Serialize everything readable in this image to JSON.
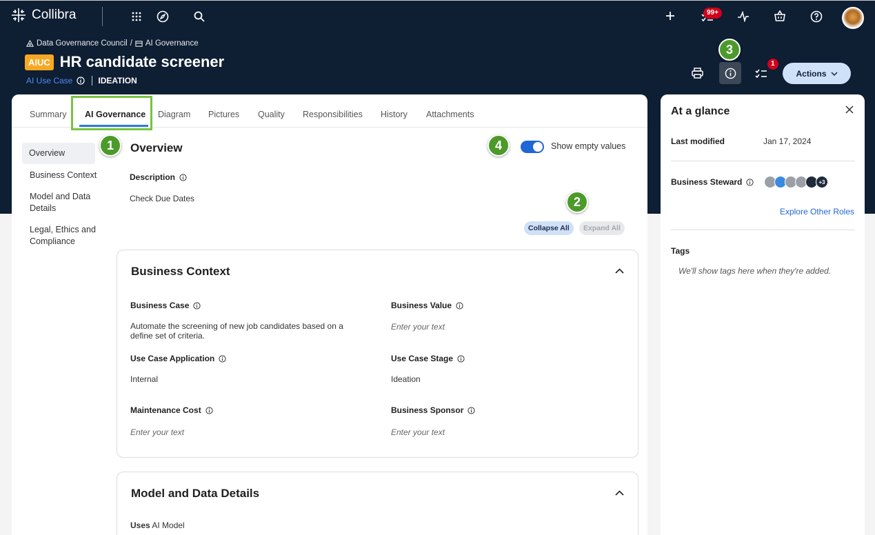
{
  "app": {
    "name": "Collibra"
  },
  "topnav": {
    "tasks_badge": "99+",
    "notifications_badge": "1"
  },
  "breadcrumb": {
    "community": "Data Governance Council",
    "separator": "/",
    "domain": "AI Governance"
  },
  "asset": {
    "type_badge": "AIUC",
    "title": "HR candidate screener",
    "type": "AI Use Case",
    "status": "IDEATION"
  },
  "header": {
    "actions_label": "Actions"
  },
  "callouts": {
    "c1": "1",
    "c2": "2",
    "c3": "3",
    "c4": "4"
  },
  "tabs": [
    {
      "label": "Summary"
    },
    {
      "label": "AI Governance"
    },
    {
      "label": "Diagram"
    },
    {
      "label": "Pictures"
    },
    {
      "label": "Quality"
    },
    {
      "label": "Responsibilities"
    },
    {
      "label": "History"
    },
    {
      "label": "Attachments"
    }
  ],
  "sidenav": [
    {
      "label": "Overview"
    },
    {
      "label": "Business Context"
    },
    {
      "label": "Model and Data Details"
    },
    {
      "label": "Legal, Ethics and Compliance"
    }
  ],
  "overview": {
    "title": "Overview",
    "show_empty_label": "Show empty values",
    "description_label": "Description",
    "description_value": "Check Due Dates",
    "collapse_all": "Collapse All",
    "expand_all": "Expand All"
  },
  "business_context": {
    "title": "Business Context",
    "fields": [
      {
        "label": "Business Case",
        "value": "Automate the screening of new job candidates based on a define set of criteria."
      },
      {
        "label": "Business Value",
        "value": "Enter your text"
      },
      {
        "label": "Use Case Application",
        "value": "Internal"
      },
      {
        "label": "Use Case Stage",
        "value": "Ideation"
      },
      {
        "label": "Maintenance Cost",
        "value": "Enter your text"
      },
      {
        "label": "Business Sponsor",
        "value": "Enter your text"
      }
    ]
  },
  "model_data": {
    "title": "Model and Data Details",
    "uses_label": "Uses",
    "uses_value": "AI Model"
  },
  "side_panel": {
    "title": "At a glance",
    "last_modified_label": "Last modified",
    "last_modified_value": "Jan 17, 2024",
    "steward_label": "Business Steward",
    "more_count": "+3",
    "explore_link": "Explore Other Roles",
    "tags_label": "Tags",
    "tags_empty": "We'll show tags here when they're added."
  }
}
